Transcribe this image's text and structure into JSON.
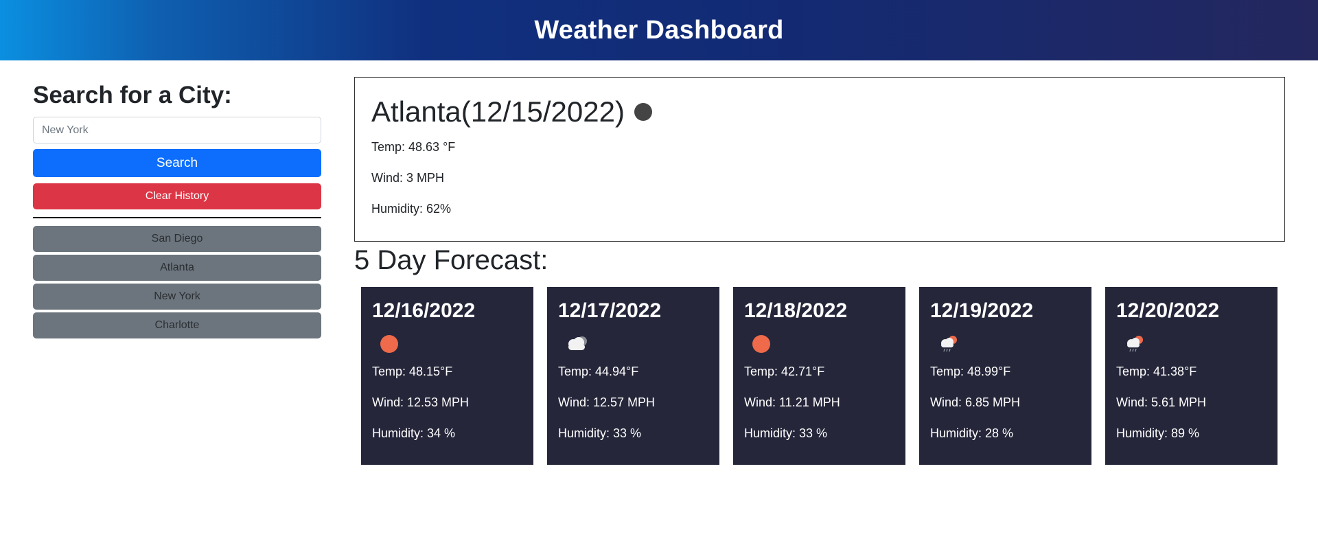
{
  "header": {
    "title": "Weather Dashboard"
  },
  "sidebar": {
    "heading": "Search for a City:",
    "search_placeholder": "New York",
    "search_label": "Search",
    "clear_label": "Clear History",
    "history": [
      "San Diego",
      "Atlanta",
      "New York",
      "Charlotte"
    ]
  },
  "current": {
    "title": "Atlanta(12/15/2022)",
    "icon": "dark-dot-icon",
    "temp": "Temp: 48.63 °F",
    "wind": "Wind: 3 MPH",
    "humidity": "Humidity: 62%"
  },
  "forecast": {
    "heading": "5 Day Forecast:",
    "days": [
      {
        "date": "12/16/2022",
        "icon": "sun-icon",
        "temp": "Temp: 48.15°F",
        "wind": "Wind: 12.53 MPH",
        "humidity": "Humidity: 34 %"
      },
      {
        "date": "12/17/2022",
        "icon": "cloud-icon",
        "temp": "Temp: 44.94°F",
        "wind": "Wind: 12.57 MPH",
        "humidity": "Humidity: 33 %"
      },
      {
        "date": "12/18/2022",
        "icon": "sun-icon",
        "temp": "Temp: 42.71°F",
        "wind": "Wind: 11.21 MPH",
        "humidity": "Humidity: 33 %"
      },
      {
        "date": "12/19/2022",
        "icon": "rain-sun-icon",
        "temp": "Temp: 48.99°F",
        "wind": "Wind: 6.85 MPH",
        "humidity": "Humidity: 28 %"
      },
      {
        "date": "12/20/2022",
        "icon": "rain-sun-icon",
        "temp": "Temp: 41.38°F",
        "wind": "Wind: 5.61 MPH",
        "humidity": "Humidity: 89 %"
      }
    ]
  },
  "colors": {
    "primary": "#0d6efd",
    "danger": "#dc3545",
    "secondary": "#6c757d",
    "card_bg": "#25263a",
    "sun": "#ee6a4a"
  }
}
